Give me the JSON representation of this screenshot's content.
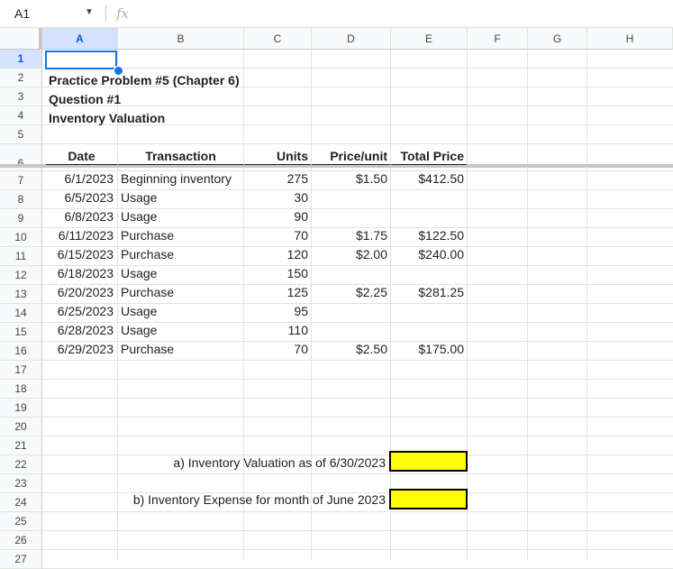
{
  "formula_bar": {
    "cell_ref": "A1",
    "fx": "fx",
    "formula": ""
  },
  "columns": [
    "A",
    "B",
    "C",
    "D",
    "E",
    "F",
    "G",
    "H"
  ],
  "rows": [
    "1",
    "2",
    "3",
    "4",
    "5",
    "6",
    "7",
    "8",
    "9",
    "10",
    "11",
    "12",
    "13",
    "14",
    "15",
    "16",
    "17",
    "18",
    "19",
    "20",
    "21",
    "22",
    "23",
    "24",
    "25",
    "26",
    "27"
  ],
  "titles": {
    "line1": "Practice Problem #5 (Chapter 6)",
    "line2": "Question #1",
    "line3": "Inventory Valuation"
  },
  "table": {
    "headers": {
      "date": "Date",
      "transaction": "Transaction",
      "units": "Units",
      "price": "Price/unit",
      "total": "Total Price"
    },
    "rows": [
      {
        "date": "6/1/2023",
        "transaction": "Beginning inventory",
        "units": "275",
        "price": "$1.50",
        "total": "$412.50"
      },
      {
        "date": "6/5/2023",
        "transaction": "Usage",
        "units": "30",
        "price": "",
        "total": ""
      },
      {
        "date": "6/8/2023",
        "transaction": "Usage",
        "units": "90",
        "price": "",
        "total": ""
      },
      {
        "date": "6/11/2023",
        "transaction": "Purchase",
        "units": "70",
        "price": "$1.75",
        "total": "$122.50"
      },
      {
        "date": "6/15/2023",
        "transaction": "Purchase",
        "units": "120",
        "price": "$2.00",
        "total": "$240.00"
      },
      {
        "date": "6/18/2023",
        "transaction": "Usage",
        "units": "150",
        "price": "",
        "total": ""
      },
      {
        "date": "6/20/2023",
        "transaction": "Purchase",
        "units": "125",
        "price": "$2.25",
        "total": "$281.25"
      },
      {
        "date": "6/25/2023",
        "transaction": "Usage",
        "units": "95",
        "price": "",
        "total": ""
      },
      {
        "date": "6/28/2023",
        "transaction": "Usage",
        "units": "110",
        "price": "",
        "total": ""
      },
      {
        "date": "6/29/2023",
        "transaction": "Purchase",
        "units": "70",
        "price": "$2.50",
        "total": "$175.00"
      }
    ]
  },
  "questions": {
    "a": "a) Inventory Valuation as of 6/30/2023",
    "b": "b) Inventory Expense for month of June 2023"
  },
  "colors": {
    "highlight": "#ffff00",
    "selection": "#1a73e8"
  }
}
